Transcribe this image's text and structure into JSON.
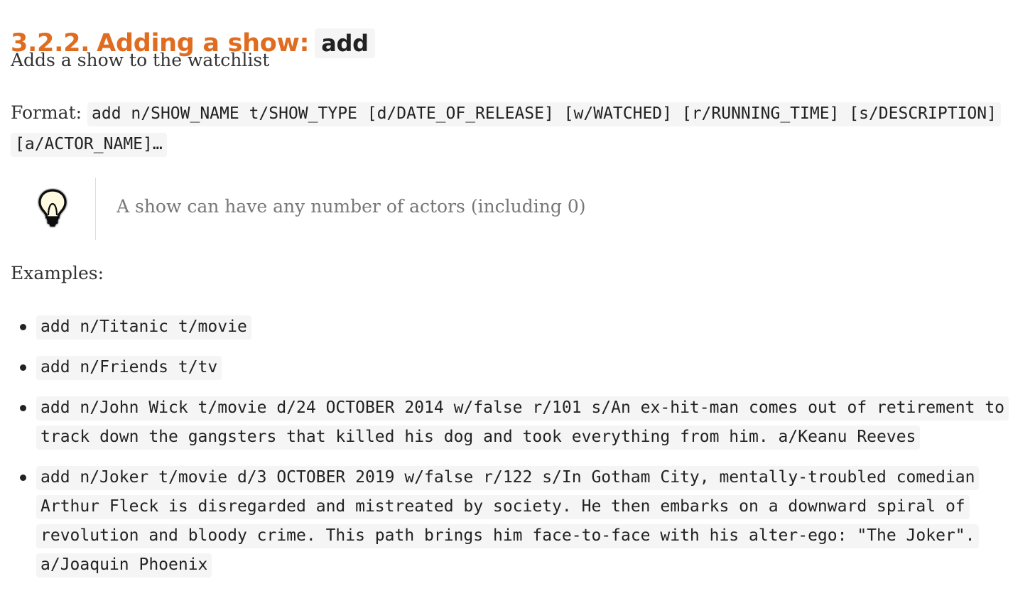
{
  "heading": {
    "number": "3.2.2.",
    "title": "Adding a show:",
    "command": "add"
  },
  "description": "Adds a show to the watchlist",
  "format": {
    "label": "Format:",
    "syntax": "add n/SHOW_NAME t/SHOW_TYPE [d/DATE_OF_RELEASE] [w/WATCHED] [r/RUNNING_TIME] [s/DESCRIPTION] [a/ACTOR_NAME]…"
  },
  "tip": {
    "icon": "lightbulb-icon",
    "text": "A show can have any number of actors (including 0)"
  },
  "examples": {
    "label": "Examples:",
    "items": [
      "add n/Titanic t/movie",
      "add n/Friends t/tv",
      "add n/John Wick t/movie d/24 OCTOBER 2014 w/false r/101 s/An ex-hit-man comes out of retirement to track down the gangsters that killed his dog and took everything from him. a/Keanu Reeves",
      "add n/Joker t/movie d/3 OCTOBER 2019 w/false r/122 s/In Gotham City, mentally-troubled comedian Arthur Fleck is disregarded and mistreated by society. He then embarks on a downward spiral of revolution and bloody crime. This path brings him face-to-face with his alter-ego: \"The Joker\". a/Joaquin Phoenix"
    ]
  },
  "colors": {
    "heading": "#e06c1f",
    "code_background": "#f5f5f5",
    "tip_text": "#777777"
  }
}
